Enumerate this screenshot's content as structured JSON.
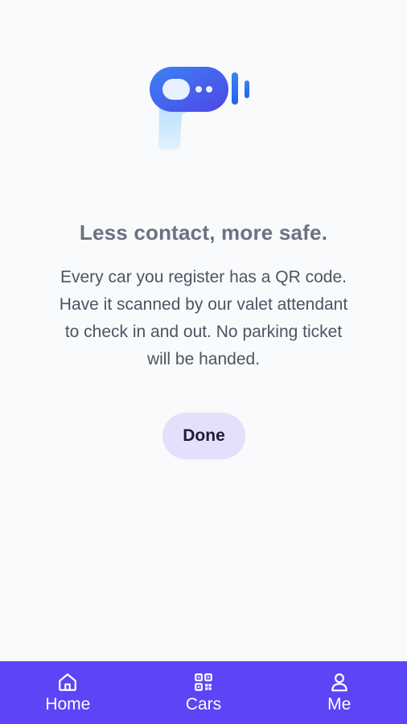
{
  "onboarding": {
    "headline": "Less contact, more safe.",
    "body_lines": [
      "Every car you register has a QR code.",
      "Have it scanned by our valet attendant",
      "to check in and out. No parking ticket",
      "will be handed."
    ],
    "illustration_icon": "qr-scanner-gun-icon",
    "done_label": "Done"
  },
  "nav": {
    "items": [
      {
        "label": "Home",
        "icon": "home-icon"
      },
      {
        "label": "Cars",
        "icon": "qr-code-icon"
      },
      {
        "label": "Me",
        "icon": "person-icon"
      }
    ]
  },
  "colors": {
    "background": "#f8fafc",
    "nav_background": "#5b45f6",
    "button_background": "#e3e0fb",
    "headline": "#6b7280",
    "body": "#4b5563",
    "scanner_gradient_start": "#2f7df6",
    "scanner_gradient_end": "#4f46e5"
  }
}
